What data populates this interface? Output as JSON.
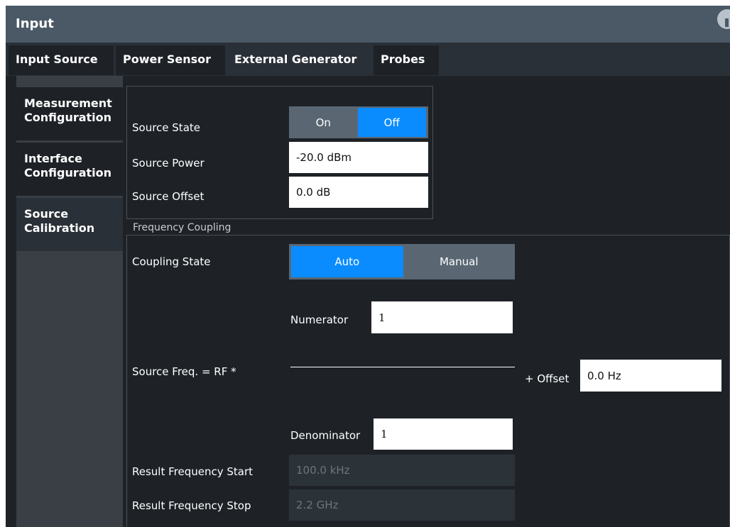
{
  "window": {
    "title": "Input"
  },
  "tabs": [
    {
      "label": "Input Source"
    },
    {
      "label": "Power Sensor"
    },
    {
      "label": "External Generator"
    },
    {
      "label": "Probes"
    }
  ],
  "sidebar": {
    "items": [
      {
        "label": "Measurement\nConfiguration"
      },
      {
        "label": "Interface\nConfiguration"
      },
      {
        "label": "Source\nCalibration"
      }
    ]
  },
  "source": {
    "state_label": "Source State",
    "state_on": "On",
    "state_off": "Off",
    "power_label": "Source Power",
    "power_value": "-20.0 dBm",
    "offset_label": "Source Offset",
    "offset_value": "0.0 dB"
  },
  "coupling": {
    "group_label": "Frequency Coupling",
    "state_label": "Coupling State",
    "auto": "Auto",
    "manual": "Manual",
    "numerator_label": "Numerator",
    "numerator_value": "1",
    "formula_label": "Source Freq. = RF *",
    "offset_label": "+ Offset",
    "offset_value": "0.0 Hz",
    "denominator_label": "Denominator",
    "denominator_value": "1",
    "result_start_label": "Result Frequency Start",
    "result_start_value": "100.0 kHz",
    "result_stop_label": "Result Frequency Stop",
    "result_stop_value": "2.2 GHz"
  },
  "colors": {
    "accent": "#0a8cff",
    "titlebar": "#4b5966",
    "background": "#1e2227"
  }
}
